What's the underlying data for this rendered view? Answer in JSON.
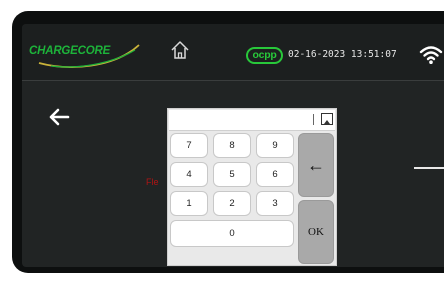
{
  "header": {
    "logo_text": "CHARGECORE",
    "ocpp_label": "ocpp",
    "datetime": "02-16-2023 13:51:07"
  },
  "screen": {
    "background_label_partial": "Fle"
  },
  "keypad": {
    "input_value": "",
    "digits": [
      "7",
      "8",
      "9",
      "4",
      "5",
      "6",
      "1",
      "2",
      "3",
      "0"
    ],
    "backspace_symbol": "←",
    "ok_label": "OK"
  },
  "icons": {
    "home": "home-icon",
    "back": "back-arrow-icon",
    "wifi": "wifi-icon",
    "toggle": "collapse-triangle-icon"
  },
  "colors": {
    "accent_green": "#28c83a",
    "screen_background": "#212424",
    "hidden_label_red": "#b01414"
  }
}
